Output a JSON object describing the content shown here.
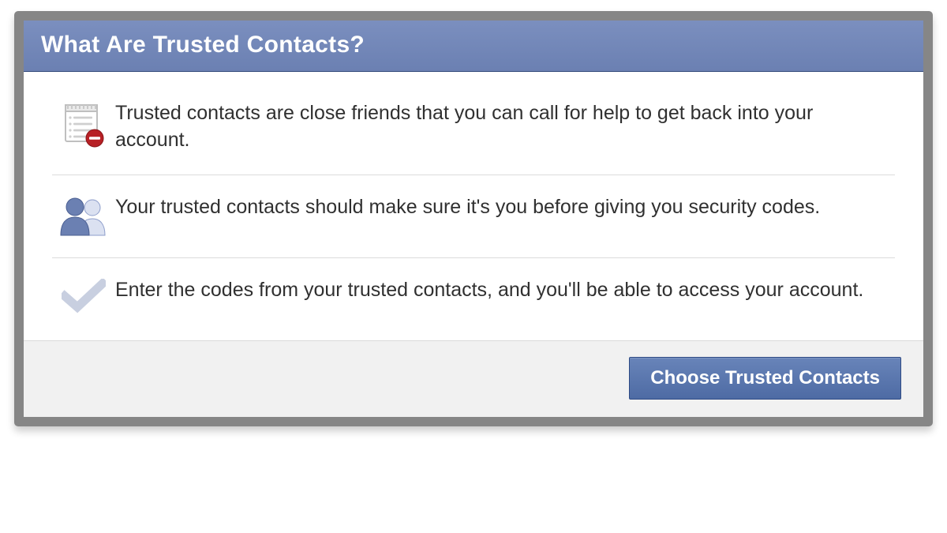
{
  "dialog": {
    "title": "What Are Trusted Contacts?",
    "rows": [
      {
        "icon": "notepad-blocked-icon",
        "text": "Trusted contacts are close friends that you can call for help to get back into your account."
      },
      {
        "icon": "friends-icon",
        "text": "Your trusted contacts should make sure it's you before giving you security codes."
      },
      {
        "icon": "checkmark-icon",
        "text": "Enter the codes from your trusted contacts, and you'll be able to access your account."
      }
    ],
    "footer": {
      "primary_button": "Choose Trusted Contacts"
    }
  },
  "colors": {
    "header_bg": "#6f84b5",
    "button_bg": "#5875ad",
    "border_gray": "#868686"
  }
}
